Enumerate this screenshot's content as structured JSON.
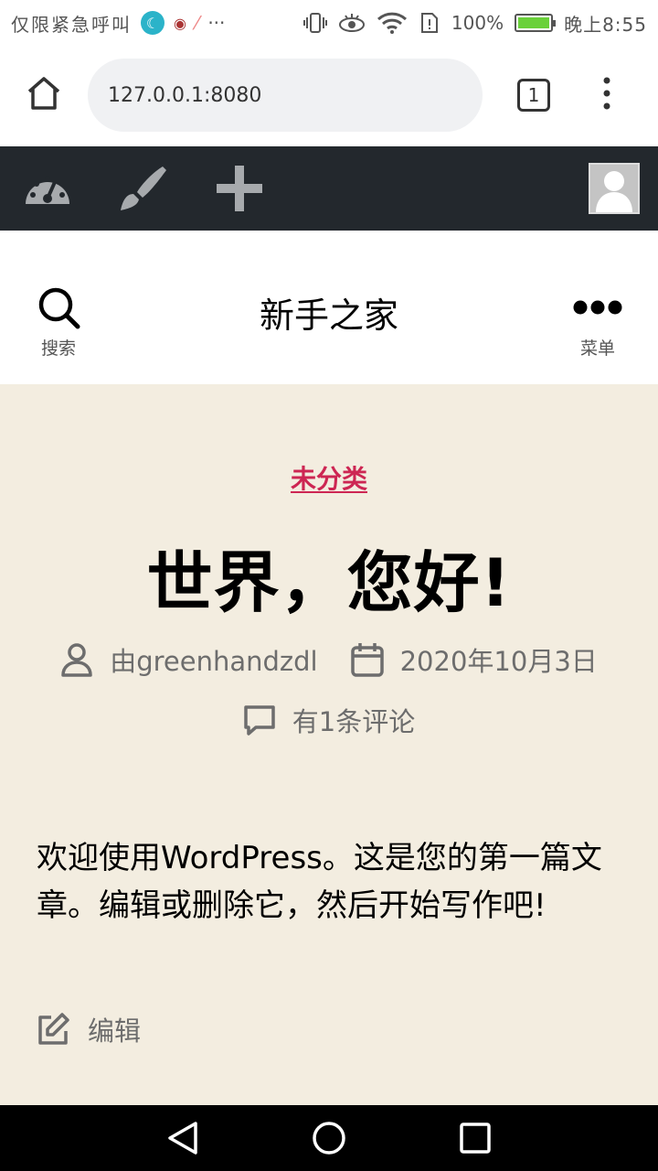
{
  "status_bar": {
    "carrier": "仅限紧急呼叫",
    "more": "···",
    "battery": "100%",
    "time": "晚上8:55"
  },
  "browser": {
    "url": "127.0.0.1:8080",
    "tab_count": "1"
  },
  "header": {
    "site_title": "新手之家",
    "search_label": "搜索",
    "menu_label": "菜单"
  },
  "post": {
    "category": "未分类",
    "title": "世界，您好!",
    "author": "由greenhandzdl",
    "date": "2020年10月3日",
    "comments": "有1条评论",
    "body": "欢迎使用WordPress。这是您的第一篇文章。编辑或删除它，然后开始写作吧!",
    "edit_label": "编辑"
  },
  "colors": {
    "accent": "#cd2653",
    "admin_bar": "#23282d",
    "content_bg": "#f3ede0"
  }
}
